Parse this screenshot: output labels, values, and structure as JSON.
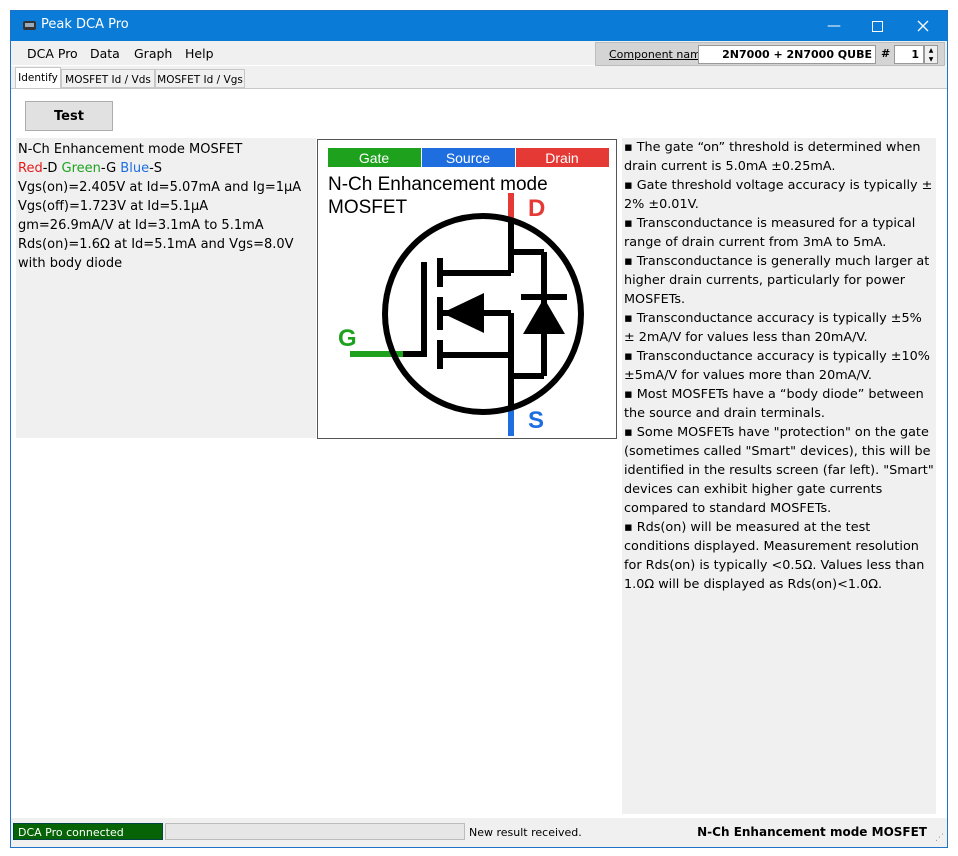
{
  "window": {
    "title": "Peak DCA Pro"
  },
  "menu": [
    "DCA Pro",
    "Data",
    "Graph",
    "Help"
  ],
  "component": {
    "label": "Component name",
    "value": "2N7000 + 2N7000 QUBE",
    "hash": "#",
    "index": "1"
  },
  "tabs": [
    "Identify",
    "MOSFET Id / Vds",
    "MOSFET Id / Vgs"
  ],
  "test_button": "Test",
  "results": {
    "title": "N-Ch Enhancement mode MOSFET",
    "pins": {
      "red": "Red",
      "d": "-D ",
      "green": "Green",
      "g": "-G ",
      "blue": "Blue",
      "s": "-S"
    },
    "lines": [
      "Vgs(on)=2.405V at Id=5.07mA and Ig=1µA",
      "Vgs(off)=1.723V at Id=5.1µA",
      "gm=26.9mA/V at Id=3.1mA to 5.1mA",
      "Rds(on)=1.6Ω at Id=5.1mA and Vgs=8.0V",
      "with body diode"
    ]
  },
  "diagram": {
    "legend": [
      "Gate",
      "Source",
      "Drain"
    ],
    "caption_line1": "N-Ch Enhancement mode",
    "caption_line2": "MOSFET",
    "pin_d": "D",
    "pin_g": "G",
    "pin_s": "S",
    "colors": {
      "gate": "#1ea21e",
      "source": "#1e6ee0",
      "drain": "#e53935"
    }
  },
  "notes": [
    "▪ The gate “on” threshold is determined when drain current is 5.0mA ±0.25mA.",
    "▪ Gate threshold voltage accuracy is typically ± 2% ±0.01V.",
    "▪ Transconductance is measured for a typical range of drain current from 3mA to 5mA.",
    "▪ Transconductance is generally much larger at higher drain currents, particularly for power MOSFETs.",
    "▪ Transconductance accuracy is typically ±5% ± 2mA/V for values less than 20mA/V.",
    "▪ Transconductance accuracy is typically ±10% ±5mA/V for values more than 20mA/V.",
    "▪ Most MOSFETs have a “body diode” between the source and drain terminals.",
    "▪ Some MOSFETs have \"protection\" on the gate (sometimes called \"Smart\" devices), this will be identified in the results screen (far left). \"Smart\" devices can exhibit higher gate currents compared to standard MOSFETs.",
    "▪ Rds(on) will be measured at the test conditions displayed. Measurement resolution for Rds(on) is typically <0.5Ω. Values less than 1.0Ω will be displayed as Rds(on)<1.0Ω."
  ],
  "status": {
    "connection": "DCA Pro connected",
    "message": "New result received.",
    "component_type": "N-Ch Enhancement mode MOSFET"
  }
}
